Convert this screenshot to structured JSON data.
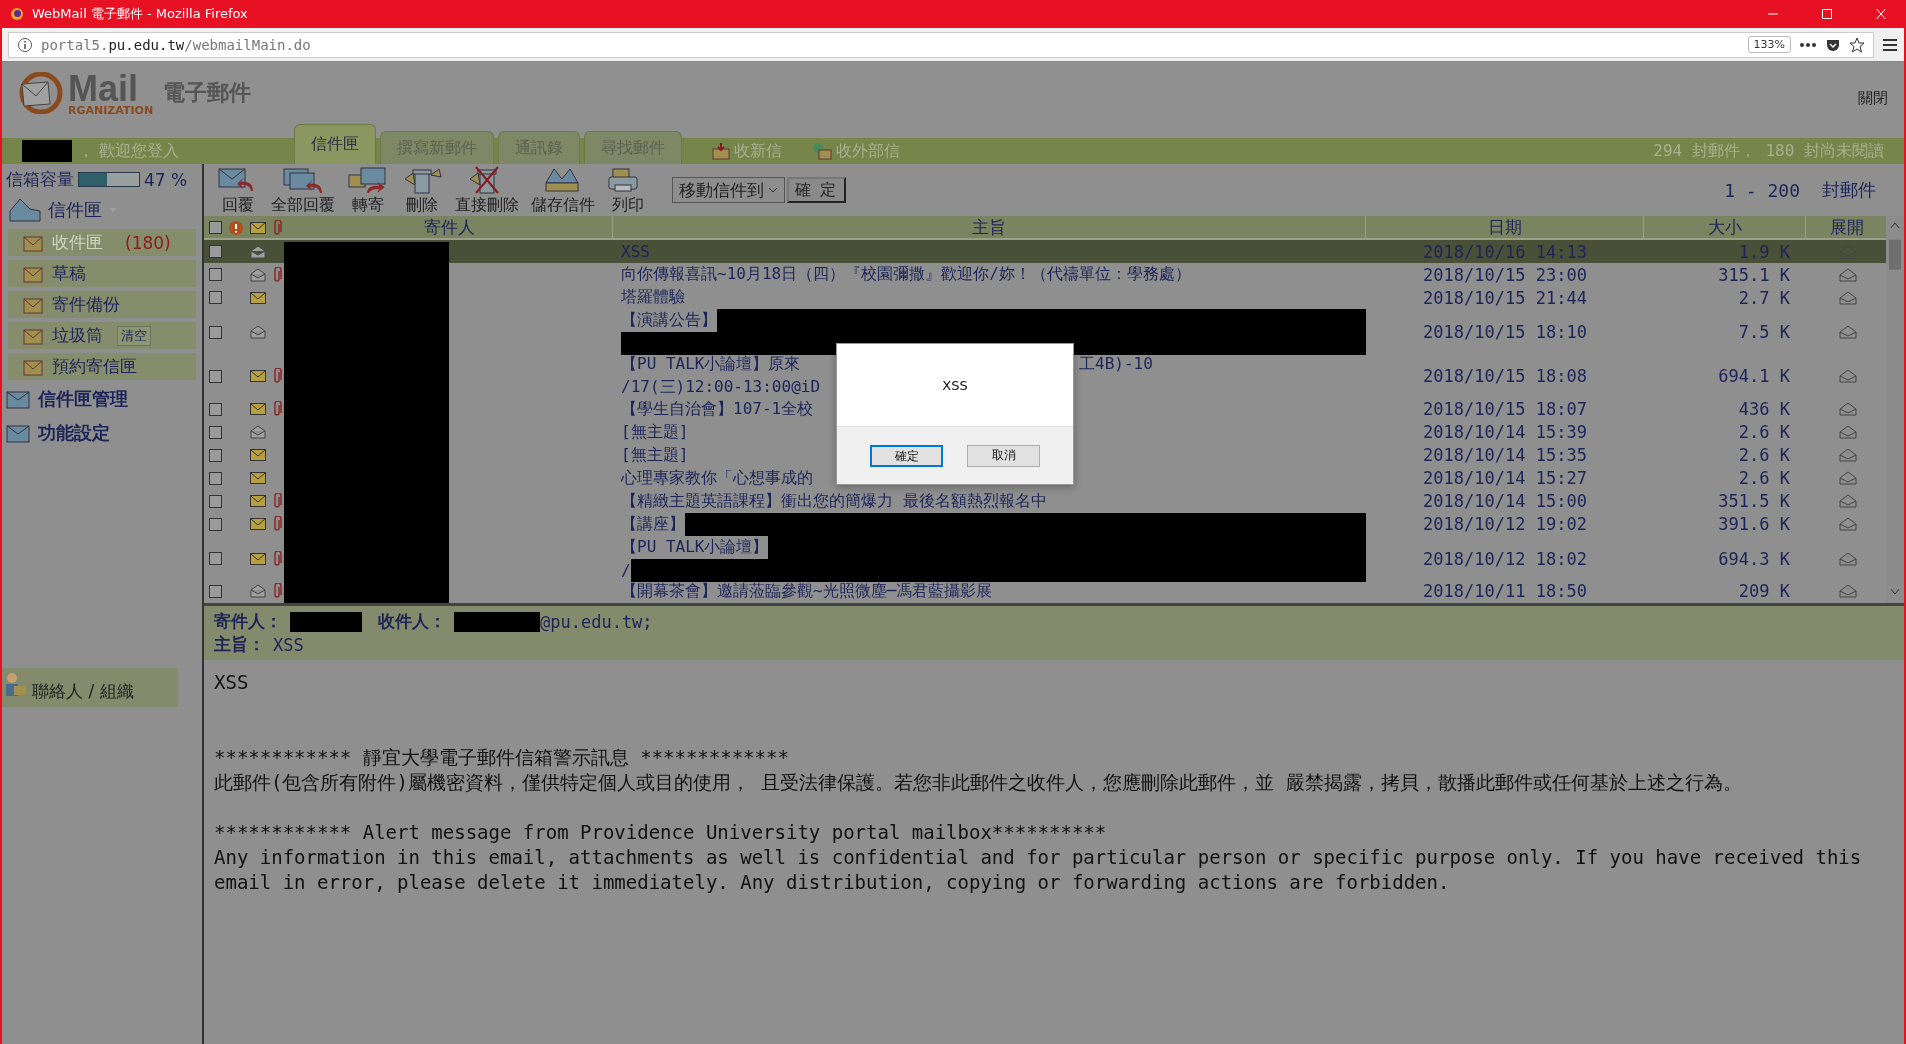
{
  "browser": {
    "title": "WebMail 電子郵件 - Mozilla Firefox",
    "url_prefix": "portal5.",
    "url_domain": "pu.edu.tw",
    "url_path": "/webmailMain.do",
    "zoom": "133%"
  },
  "header": {
    "logo_text": "Mail",
    "logo_subtext": "RGANIZATION",
    "logo_title": "電子郵件",
    "close_link": "關閉"
  },
  "welcome": "， 歡迎您登入",
  "tabs": [
    {
      "label": "信件匣",
      "selected": true
    },
    {
      "label": "撰寫新郵件",
      "selected": false
    },
    {
      "label": "通訊錄",
      "selected": false
    },
    {
      "label": "尋找郵件",
      "selected": false
    }
  ],
  "quick_links": [
    "收新信",
    "收外部信"
  ],
  "mail_summary": "294 封郵件， 180 封尚未閱讀",
  "sidebar": {
    "quota": {
      "label": "信箱容量",
      "level": 0.47,
      "reading": "47 %"
    },
    "root": "信件匣",
    "folders": [
      {
        "label": "收件匣",
        "count": "(180)",
        "selected": true
      },
      {
        "label": "草稿",
        "selected": false
      },
      {
        "label": "寄件備份",
        "selected": false
      },
      {
        "label": "垃圾筒",
        "action": "清空",
        "selected": false
      },
      {
        "label": "預約寄信匣",
        "selected": false
      }
    ],
    "sections": [
      "信件匣管理",
      "功能設定"
    ],
    "contacts": "聯絡人 / 組織"
  },
  "toolbar": {
    "actions": [
      "回覆",
      "全部回覆",
      "轉寄",
      "刪除",
      "直接刪除",
      "儲存信件",
      "列印"
    ],
    "move_select": "移動信件到",
    "confirm": "確 定",
    "range": "1 - 200",
    "range_unit": "封郵件"
  },
  "table": {
    "select_all": {
      "checked": false
    },
    "columns": [
      "寄件人",
      "主旨",
      "日期",
      "大小",
      "展開"
    ],
    "rows": [
      {
        "selected": true,
        "read": true,
        "attachment": false,
        "subject": [
          [
            {
              "text": "XSS"
            }
          ]
        ],
        "date": "2018/10/16 14:13",
        "size": "1.9 K"
      },
      {
        "selected": false,
        "read": true,
        "attachment": true,
        "subject": [
          [
            {
              "text": "向你傳報喜訊~10月18日（四）『校園彌撒』歡迎你/妳！（代禱單位：學務處）"
            }
          ]
        ],
        "date": "2018/10/15 23:00",
        "size": "315.1 K"
      },
      {
        "selected": false,
        "read": false,
        "attachment": false,
        "subject": [
          [
            {
              "text": "塔羅體驗"
            }
          ]
        ],
        "date": "2018/10/15 21:44",
        "size": "2.7 K"
      },
      {
        "selected": false,
        "read": true,
        "attachment": false,
        "subject": [
          [
            {
              "text": "【演講公告】"
            },
            {
              "kind": "redaction"
            }
          ],
          [
            {
              "kind": "redaction"
            }
          ]
        ],
        "date": "2018/10/15 18:10",
        "size": "7.5 K"
      },
      {
        "selected": false,
        "read": false,
        "attachment": true,
        "subject": [
          [
            {
              "text": "【PU TALK小論壇】原來"
            },
            {
              "kind": "tail",
              "text": "工4B)-10"
            }
          ],
          [
            {
              "text": "/17(三)12:00-13:00@iD"
            }
          ]
        ],
        "date": "2018/10/15 18:08",
        "size": "694.1 K"
      },
      {
        "selected": false,
        "read": false,
        "attachment": true,
        "subject": [
          [
            {
              "text": "【學生自治會】107-1全校"
            }
          ]
        ],
        "date": "2018/10/15 18:07",
        "size": "436 K"
      },
      {
        "selected": false,
        "read": true,
        "attachment": false,
        "subject": [
          [
            {
              "text": "[無主題]"
            }
          ]
        ],
        "date": "2018/10/14 15:39",
        "size": "2.6 K"
      },
      {
        "selected": false,
        "read": false,
        "attachment": false,
        "subject": [
          [
            {
              "text": "[無主題]"
            }
          ]
        ],
        "date": "2018/10/14 15:35",
        "size": "2.6 K"
      },
      {
        "selected": false,
        "read": false,
        "attachment": false,
        "subject": [
          [
            {
              "text": "心理專家教你「心想事成的"
            }
          ]
        ],
        "date": "2018/10/14 15:27",
        "size": "2.6 K"
      },
      {
        "selected": false,
        "read": false,
        "attachment": true,
        "subject": [
          [
            {
              "text": "【精緻主題英語課程】衝出您的簡爆力 最後名額熱烈報名中"
            }
          ]
        ],
        "date": "2018/10/14 15:00",
        "size": "351.5 K"
      },
      {
        "selected": false,
        "read": false,
        "attachment": true,
        "subject": [
          [
            {
              "text": "【講座】"
            },
            {
              "kind": "redaction"
            }
          ]
        ],
        "date": "2018/10/12 19:02",
        "size": "391.6 K"
      },
      {
        "selected": false,
        "read": false,
        "attachment": true,
        "subject": [
          [
            {
              "text": "【PU TALK小論壇】"
            },
            {
              "kind": "redaction"
            }
          ],
          [
            {
              "text": "/"
            },
            {
              "kind": "redaction"
            }
          ]
        ],
        "date": "2018/10/12 18:02",
        "size": "694.3 K"
      },
      {
        "selected": false,
        "read": true,
        "attachment": true,
        "subject": [
          [
            {
              "text": "【開幕茶會】邀請蒞臨參觀~光照微塵─馮君藍攝影展"
            }
          ]
        ],
        "date": "2018/10/11 18:50",
        "size": "209 K"
      }
    ]
  },
  "preview": {
    "from_label": "寄件人：",
    "to_label": "收件人：",
    "to_suffix": "@pu.edu.tw;",
    "subject_label": "主旨：",
    "subject": "XSS",
    "body": [
      [
        "XSS"
      ],
      [
        "************ 靜宜大學電子郵件信箱警示訊息 *************",
        "此郵件(包含所有附件)屬機密資料，僅供特定個人或目的使用， 且受法律保護。若您非此郵件之收件人，您應刪除此郵件，並 嚴禁揭露，拷貝，散播此郵件或任何基於上述之行為。"
      ],
      [
        "************ Alert message from Providence University portal mailbox**********",
        "Any information in this email, attachments as well is confidential and for particular person or specific purpose only. If you have received this email in error, please delete it immediately. Any distribution, copying or forwarding actions are forbidden."
      ]
    ]
  },
  "dialog": {
    "message": "XSS",
    "buttons": [
      {
        "label": "確定",
        "selected": true
      },
      {
        "label": "取消",
        "selected": false
      }
    ]
  }
}
